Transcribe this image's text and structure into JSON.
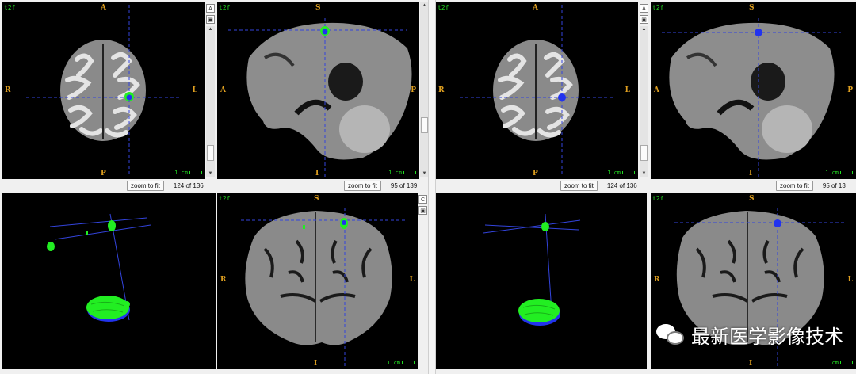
{
  "left": {
    "axial": {
      "sequence": "t2f",
      "orient": {
        "top": "A",
        "bottom": "P",
        "left": "R",
        "right": "L"
      },
      "scale": "1 cm"
    },
    "sagittal": {
      "sequence": "t2f",
      "orient": {
        "top": "S",
        "bottom": "I",
        "left": "A",
        "right": "P"
      },
      "scale": "1 cm"
    },
    "coronal": {
      "sequence": "t2f",
      "orient": {
        "top": "S",
        "bottom": "I",
        "left": "R",
        "right": "L"
      },
      "scale": "1 cm"
    },
    "status_axial": {
      "zoom_label": "zoom to fit",
      "slice_label": "124 of 136"
    },
    "status_sagittal": {
      "zoom_label": "zoom to fit",
      "slice_label": "95 of 139"
    },
    "toolbar": {
      "btn1": "A",
      "btn2": "▣",
      "btn3": "C",
      "btn4": "▣"
    }
  },
  "right": {
    "axial": {
      "sequence": "t2f",
      "orient": {
        "top": "A",
        "bottom": "P",
        "left": "R",
        "right": "L"
      },
      "scale": "1 cm"
    },
    "sagittal": {
      "sequence": "t2f",
      "orient": {
        "top": "S",
        "bottom": "I",
        "left": "A",
        "right": "P"
      },
      "scale": "1 cm"
    },
    "coronal": {
      "sequence": "t2f",
      "orient": {
        "top": "S",
        "bottom": "I",
        "left": "R",
        "right": "L"
      },
      "scale": "1 cm"
    },
    "status_axial": {
      "zoom_label": "zoom to fit",
      "slice_label": "124 of 136"
    },
    "status_sagittal": {
      "zoom_label": "zoom to fit",
      "slice_label": "95 of 13"
    },
    "toolbar": {
      "btn1": "A",
      "btn2": "▣"
    }
  },
  "watermark": {
    "text": "最新医学影像技术",
    "icon": "wechat-icon"
  },
  "colors": {
    "seg_green": "#22ee22",
    "seg_blue": "#2233ee",
    "crosshair": "#3344dd",
    "orient_label": "#e0a020"
  }
}
